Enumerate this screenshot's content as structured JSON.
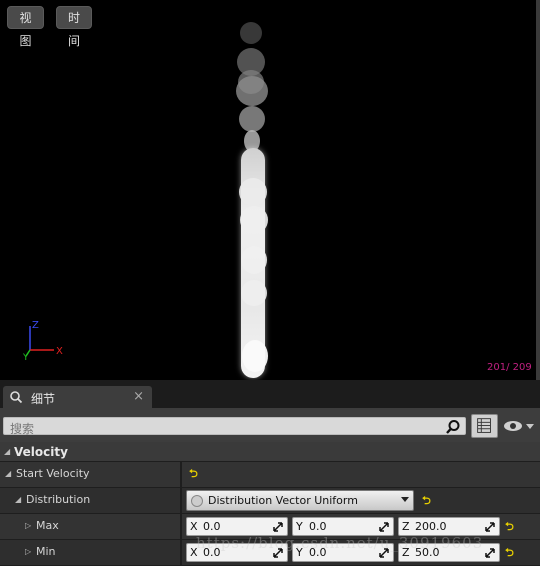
{
  "viewport": {
    "view_button": "视图",
    "time_button": "时间",
    "particle_count": "201/ 209",
    "axes": {
      "x": "X",
      "y": "Y",
      "z": "Z"
    }
  },
  "details": {
    "tab_label": "细节",
    "tab_close": "×",
    "search_placeholder": "搜索",
    "category": "Velocity",
    "rows": {
      "start_velocity": {
        "label": "Start Velocity"
      },
      "distribution": {
        "label": "Distribution",
        "value": "Distribution Vector Uniform"
      },
      "max": {
        "label": "Max",
        "x_axis": "X",
        "x": "0.0",
        "y_axis": "Y",
        "y": "0.0",
        "z_axis": "Z",
        "z": "200.0"
      },
      "min": {
        "label": "Min",
        "x_axis": "X",
        "x": "0.0",
        "y_axis": "Y",
        "y": "0.0",
        "z_axis": "Z",
        "z": "50.0"
      }
    }
  },
  "watermark": "https://blog.csdn.net/u_30919603",
  "colors": {
    "particle": "#ffffff",
    "counter": "#c02080",
    "reset_arrow": "#e8d000"
  }
}
